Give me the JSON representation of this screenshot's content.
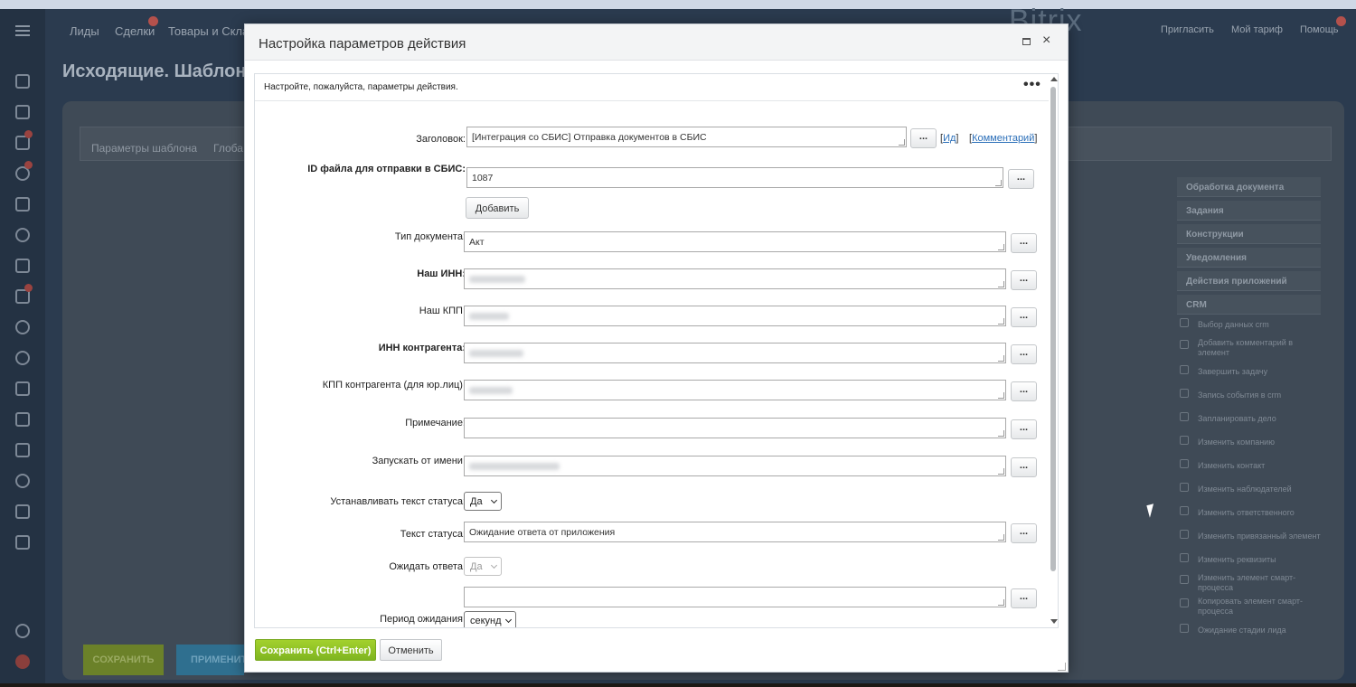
{
  "background": {
    "nav": [
      "Лиды",
      "Сделки",
      "Товары и Скла"
    ],
    "nav_badge": "1",
    "logo": "Bitrix",
    "actions": [
      "Пригласить",
      "Мой тариф",
      "Помощь"
    ],
    "page_title": "Исходящие. Шаблон",
    "tabs": [
      "Параметры шаблона",
      "Глоба"
    ],
    "save_button": "СОХРАНИТЬ",
    "apply_button": "ПРИМЕНИТ",
    "side_groups": [
      "Обработка документа",
      "Задания",
      "Конструкции",
      "Уведомления",
      "Действия приложений",
      "CRM"
    ],
    "side_items": [
      "Выбор данных crm",
      "Добавить комментарий в элемент",
      "Завершить задачу",
      "Запись события в crm",
      "Запланировать дело",
      "Изменить компанию",
      "Изменить контакт",
      "Изменить наблюдателей",
      "Изменить ответственного",
      "Изменить привязанный элемент",
      "Изменить реквизиты",
      "Изменить элемент смарт-процесса",
      "Копировать элемент смарт-процесса",
      "Ожидание стадии лида"
    ]
  },
  "dialog": {
    "title": "Настройка параметров действия",
    "hint": "Настройте, пожалуйста, параметры действия.",
    "more_glyph": "•••",
    "dots_label": "...",
    "add_label": "Добавить",
    "id_link_open": "[",
    "id_link": "Ид",
    "id_link_close": "]",
    "comment_link_open": "[",
    "comment_link": "Комментарий",
    "comment_link_close": "]",
    "fields": {
      "title_label": "Заголовок:",
      "title_value": "[Интеграция со СБИС] Отправка документов в СБИС",
      "file_id_label": "ID файла для отправки в СБИС:",
      "file_id_value": "1087",
      "doc_type_label": "Тип документа:",
      "doc_type_value": "Акт",
      "our_inn_label": "Наш ИНН:",
      "our_kpp_label": "Наш КПП:",
      "contractor_inn_label": "ИНН контрагента:",
      "contractor_kpp_label": "КПП контрагента (для юр.лиц):",
      "note_label": "Примечание:",
      "note_value": "",
      "run_as_label": "Запускать от имени:",
      "set_status_label": "Устанавливать текст статуса:",
      "set_status_value": "Да",
      "status_text_label": "Текст статуса:",
      "status_text_value": "Ожидание ответа от приложения",
      "wait_label": "Ожидать ответа:",
      "wait_value": "Да",
      "extra_value": "",
      "period_label": "Период ожидания:",
      "period_value": "секунд"
    },
    "save_label": "Сохранить (Ctrl+Enter)",
    "cancel_label": "Отменить"
  }
}
